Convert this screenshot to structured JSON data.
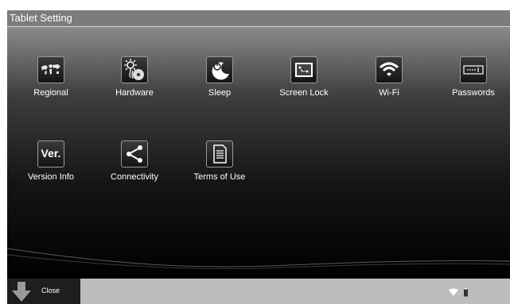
{
  "window": {
    "title": "Tablet Setting"
  },
  "tiles": [
    {
      "label": "Regional",
      "icon": "world-map-icon"
    },
    {
      "label": "Hardware",
      "icon": "hardware-sun-disc-icon"
    },
    {
      "label": "Sleep",
      "icon": "sleep-power-moon-icon"
    },
    {
      "label": "Screen Lock",
      "icon": "screen-lock-icon"
    },
    {
      "label": "Wi-Fi",
      "icon": "wifi-icon"
    },
    {
      "label": "Passwords",
      "icon": "password-field-icon"
    },
    {
      "label": "Version Info",
      "icon": "version-ver-icon",
      "icon_text": "Ver."
    },
    {
      "label": "Connectivity",
      "icon": "share-icon"
    },
    {
      "label": "Terms of Use",
      "icon": "document-icon"
    }
  ],
  "bottom_bar": {
    "close_label": "Close",
    "status_icons": [
      "wifi-icon",
      "battery-icon"
    ]
  }
}
